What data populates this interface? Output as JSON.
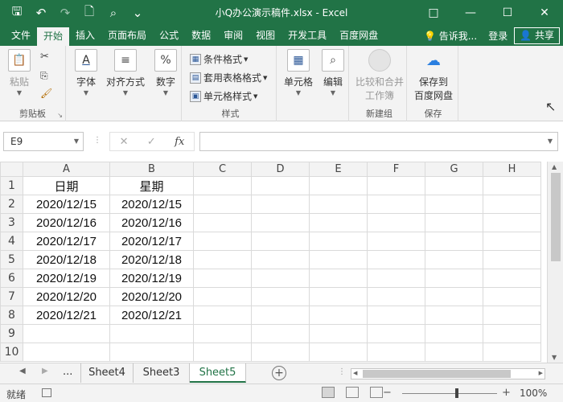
{
  "window": {
    "title": "小Q办公演示稿件.xlsx - Excel",
    "controls": {
      "restore": "□",
      "minimize": "—",
      "maximize": "☐",
      "close": "✕"
    }
  },
  "quick_access": [
    {
      "name": "save-icon",
      "glyph": "💾"
    },
    {
      "name": "undo-icon",
      "glyph": "↶"
    },
    {
      "name": "redo-icon",
      "glyph": "↷"
    },
    {
      "name": "new-file-icon",
      "glyph": "🗋"
    },
    {
      "name": "print-preview-icon",
      "glyph": "🔍"
    },
    {
      "name": "customize-icon",
      "glyph": "⌄"
    }
  ],
  "tabs": [
    "文件",
    "开始",
    "插入",
    "页面布局",
    "公式",
    "数据",
    "审阅",
    "视图",
    "开发工具",
    "百度网盘"
  ],
  "active_tab": "开始",
  "tell_me": "告诉我...",
  "login": "登录",
  "share": "共享",
  "ribbon": {
    "clipboard": {
      "paste": "粘贴",
      "label": "剪贴板"
    },
    "font": {
      "label": "字体"
    },
    "align": {
      "label": "对齐方式"
    },
    "number": {
      "label": "数字"
    },
    "styles": {
      "conditional": "条件格式",
      "table_format": "套用表格格式",
      "cell_style": "单元格样式",
      "label": "样式"
    },
    "cells": {
      "label": "单元格"
    },
    "edit": {
      "label": "编辑"
    },
    "compare": {
      "label_line1": "比较和合并",
      "label_line2": "工作簿",
      "group": "新建组"
    },
    "save_baidu": {
      "label_line1": "保存到",
      "label_line2": "百度网盘",
      "group": "保存"
    }
  },
  "formula_bar": {
    "name_box": "E9",
    "fx": "fx",
    "formula": ""
  },
  "columns": [
    "A",
    "B",
    "C",
    "D",
    "E",
    "F",
    "G",
    "H"
  ],
  "rows": [
    [
      "日期",
      "星期"
    ],
    [
      "2020/12/15",
      "2020/12/15"
    ],
    [
      "2020/12/16",
      "2020/12/16"
    ],
    [
      "2020/12/17",
      "2020/12/17"
    ],
    [
      "2020/12/18",
      "2020/12/18"
    ],
    [
      "2020/12/19",
      "2020/12/19"
    ],
    [
      "2020/12/20",
      "2020/12/20"
    ],
    [
      "2020/12/21",
      "2020/12/21"
    ],
    [
      "",
      ""
    ],
    [
      "",
      ""
    ]
  ],
  "sheets": [
    "Sheet4",
    "Sheet3",
    "Sheet5"
  ],
  "active_sheet": "Sheet5",
  "sheet_ellipsis": "...",
  "status": {
    "ready": "就绪",
    "zoom": "100%"
  }
}
